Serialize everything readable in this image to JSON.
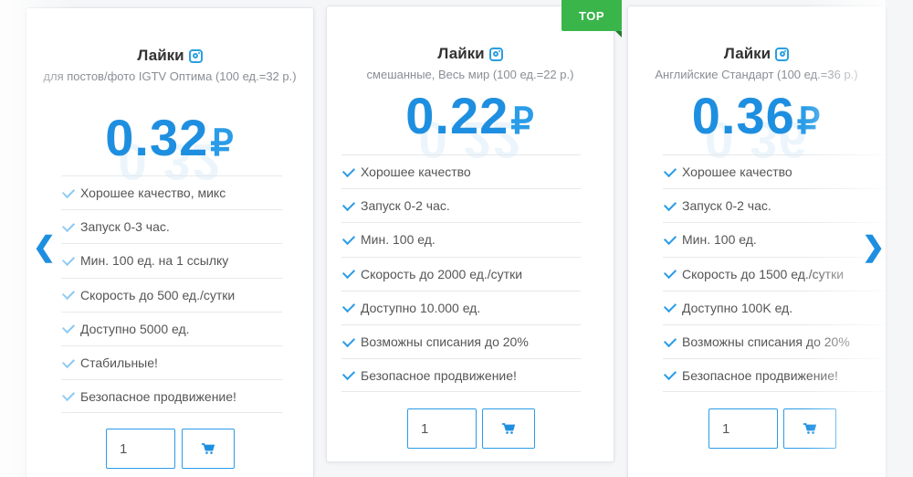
{
  "badge": "TOP",
  "nav": {
    "prev": "❮",
    "next": "❯"
  },
  "cards": [
    {
      "title": "Лайки",
      "subtitle": "для постов/фото IGTV Оптима (100 ед.=32 р.)",
      "price": "0.32",
      "currency": "₽",
      "features": [
        "Хорошее качество, микс",
        "Запуск 0-3 час.",
        "Мин. 100 ед. на 1 ссылку",
        "Скорость до 500 ед./сутки",
        "Доступно 5000 ед.",
        "Стабильные!",
        "Безопасное продвижение!"
      ],
      "quantity": "1"
    },
    {
      "title": "Лайки",
      "subtitle": "смешанные, Весь мир (100 ед.=22 р.)",
      "price": "0.22",
      "currency": "₽",
      "features": [
        "Хорошее качество",
        "Запуск 0-2 час.",
        "Мин. 100 ед.",
        "Скорость до 2000 ед./сутки",
        "Доступно 10.000 ед.",
        "Возможны списания до 20%",
        "Безопасное продвижение!"
      ],
      "quantity": "1"
    },
    {
      "title": "Лайки",
      "subtitle": "Английские Стандарт (100 ед.=36 р.)",
      "price": "0.36",
      "currency": "₽",
      "features": [
        "Хорошее качество",
        "Запуск 0-2 час.",
        "Мин. 100 ед.",
        "Скорость до 1500 ед./сутки",
        "Доступно 100K ед.",
        "Возможны списания до 20%",
        "Безопасное продвижение!"
      ],
      "quantity": "1"
    }
  ],
  "icons": {
    "title": "instagram-icon",
    "feature": "check-icon",
    "cart": "cart-icon"
  },
  "colors": {
    "accent": "#1e8fe0",
    "badge": "#3ab54a",
    "text": "#555555"
  }
}
